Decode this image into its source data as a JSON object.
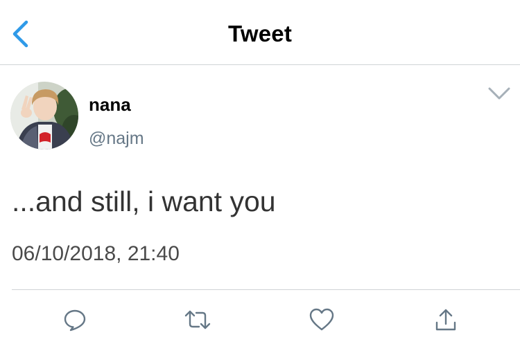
{
  "header": {
    "title": "Tweet",
    "back_icon": "chevron-left-icon",
    "accent_color": "#2f9ae8"
  },
  "tweet": {
    "author_name": "nana",
    "author_handle": "@najm",
    "text": "...and still, i want you",
    "timestamp": "06/10/2018, 21:40",
    "more_icon": "chevron-down-icon"
  },
  "actions": [
    {
      "name": "reply",
      "icon": "reply-bubble-icon"
    },
    {
      "name": "retweet",
      "icon": "retweet-icon"
    },
    {
      "name": "like",
      "icon": "heart-icon"
    },
    {
      "name": "share",
      "icon": "share-upload-icon"
    }
  ],
  "colors": {
    "icon_gray": "#657786",
    "divider": "#cfd3d6"
  }
}
